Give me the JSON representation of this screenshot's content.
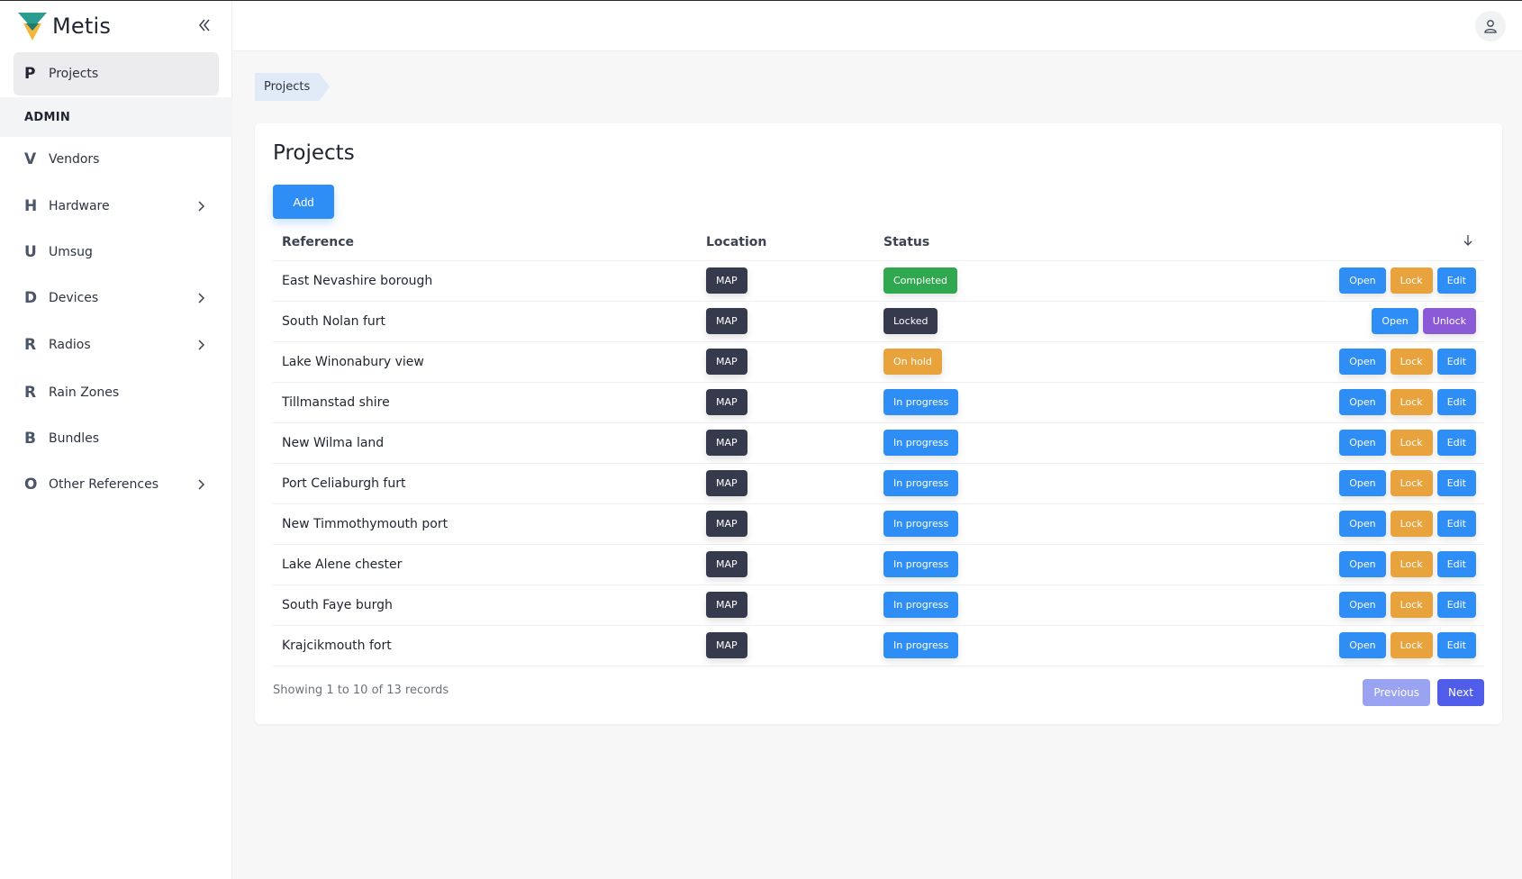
{
  "app": {
    "name": "Metis"
  },
  "colors": {
    "primary": "#2f8ef5",
    "warning": "#e8a33c",
    "success": "#2fa84f",
    "dark": "#353b4d",
    "purple": "#8b5ad6",
    "indigo": "#4f5de8",
    "indigo_light": "#99a3f2"
  },
  "sidebar": {
    "collapse_icon": "chevrons-left-icon",
    "top_item": {
      "letter": "P",
      "label": "Projects"
    },
    "section_label": "ADMIN",
    "items": [
      {
        "letter": "V",
        "label": "Vendors",
        "expandable": false
      },
      {
        "letter": "H",
        "label": "Hardware",
        "expandable": true
      },
      {
        "letter": "U",
        "label": "Umsug",
        "expandable": false
      },
      {
        "letter": "D",
        "label": "Devices",
        "expandable": true
      },
      {
        "letter": "R",
        "label": "Radios",
        "expandable": true
      },
      {
        "letter": "R",
        "label": "Rain Zones",
        "expandable": false
      },
      {
        "letter": "B",
        "label": "Bundles",
        "expandable": false
      },
      {
        "letter": "O",
        "label": "Other References",
        "expandable": true
      }
    ]
  },
  "topbar": {
    "user_icon": "user-icon"
  },
  "breadcrumb": {
    "items": [
      "Projects"
    ]
  },
  "main": {
    "title": "Projects",
    "add_label": "Add",
    "columns": [
      "Reference",
      "Location",
      "Status"
    ],
    "sort_icon": "arrow-down-icon",
    "rows": [
      {
        "reference": "East Nevashire borough",
        "location": "MAP",
        "status": "Completed",
        "status_color": "#2fa84f",
        "actions": [
          "Open",
          "Lock",
          "Edit"
        ]
      },
      {
        "reference": "South Nolan furt",
        "location": "MAP",
        "status": "Locked",
        "status_color": "#353b4d",
        "actions": [
          "Open",
          "Unlock"
        ]
      },
      {
        "reference": "Lake Winonabury view",
        "location": "MAP",
        "status": "On hold",
        "status_color": "#e8a33c",
        "actions": [
          "Open",
          "Lock",
          "Edit"
        ]
      },
      {
        "reference": "Tillmanstad shire",
        "location": "MAP",
        "status": "In progress",
        "status_color": "#2f8ef5",
        "actions": [
          "Open",
          "Lock",
          "Edit"
        ]
      },
      {
        "reference": "New Wilma land",
        "location": "MAP",
        "status": "In progress",
        "status_color": "#2f8ef5",
        "actions": [
          "Open",
          "Lock",
          "Edit"
        ]
      },
      {
        "reference": "Port Celiaburgh furt",
        "location": "MAP",
        "status": "In progress",
        "status_color": "#2f8ef5",
        "actions": [
          "Open",
          "Lock",
          "Edit"
        ]
      },
      {
        "reference": "New Timmothymouth port",
        "location": "MAP",
        "status": "In progress",
        "status_color": "#2f8ef5",
        "actions": [
          "Open",
          "Lock",
          "Edit"
        ]
      },
      {
        "reference": "Lake Alene chester",
        "location": "MAP",
        "status": "In progress",
        "status_color": "#2f8ef5",
        "actions": [
          "Open",
          "Lock",
          "Edit"
        ]
      },
      {
        "reference": "South Faye burgh",
        "location": "MAP",
        "status": "In progress",
        "status_color": "#2f8ef5",
        "actions": [
          "Open",
          "Lock",
          "Edit"
        ]
      },
      {
        "reference": "Krajcikmouth fort",
        "location": "MAP",
        "status": "In progress",
        "status_color": "#2f8ef5",
        "actions": [
          "Open",
          "Lock",
          "Edit"
        ]
      }
    ],
    "footer_text": "Showing 1 to 10 of 13 records",
    "pagination": {
      "previous": "Previous",
      "next": "Next"
    }
  }
}
